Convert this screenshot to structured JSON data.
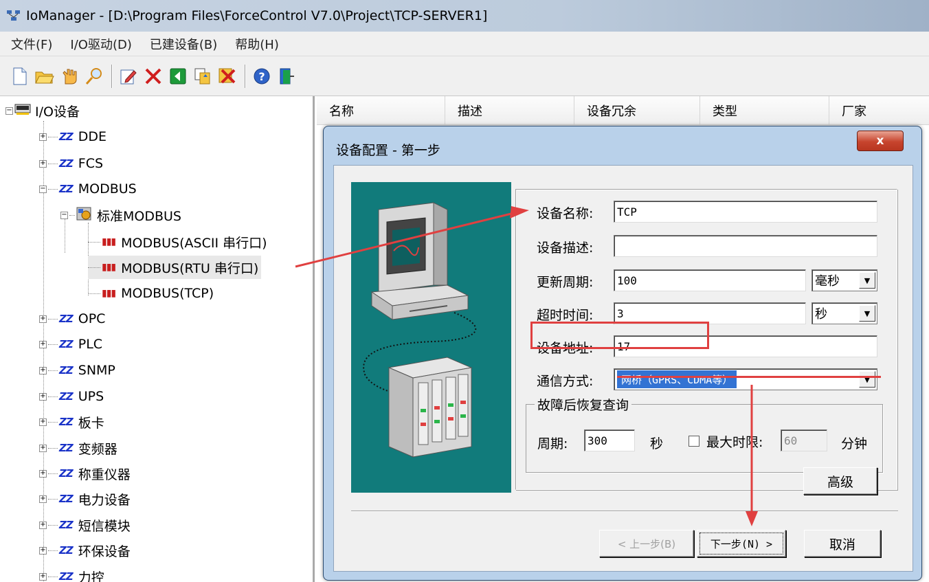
{
  "window": {
    "title": "IoManager - [D:\\Program Files\\ForceControl V7.0\\Project\\TCP-SERVER1]"
  },
  "menu": [
    "文件(F)",
    "I/O驱动(D)",
    "已建设备(B)",
    "帮助(H)"
  ],
  "toolbar": {
    "icons": [
      "new-icon",
      "open-icon",
      "hand-icon",
      "find-icon",
      "edit-icon",
      "delete-icon",
      "import-icon",
      "copy-icon",
      "delete-all-icon",
      "help-icon",
      "exit-icon"
    ]
  },
  "tree": {
    "root": "I/O设备",
    "items": [
      "DDE",
      "FCS",
      "MODBUS",
      "标准MODBUS",
      "MODBUS(ASCII 串行口)",
      "MODBUS(RTU 串行口)",
      "MODBUS(TCP)",
      "OPC",
      "PLC",
      "SNMP",
      "UPS",
      "板卡",
      "变频器",
      "称重仪器",
      "电力设备",
      "短信模块",
      "环保设备",
      "力控"
    ]
  },
  "list": {
    "columns": [
      "名称",
      "描述",
      "设备冗余",
      "类型",
      "厂家"
    ]
  },
  "dialog": {
    "title": "设备配置 - 第一步",
    "close": "x",
    "device_name_label": "设备名称:",
    "device_name": "TCP",
    "device_desc_label": "设备描述:",
    "device_desc": "",
    "update_period_label": "更新周期:",
    "update_period": "100",
    "update_unit": "毫秒",
    "timeout_label": "超时时间:",
    "timeout": "3",
    "timeout_unit": "秒",
    "address_label": "设备地址:",
    "address": "17",
    "comm_label": "通信方式:",
    "comm_value": "网桥（GPRS、CDMA等）",
    "recovery_group": "故障后恢复查询",
    "period_label": "周期:",
    "period_value": "300",
    "period_unit": "秒",
    "max_limit_label": "最大时限:",
    "max_limit_value": "60",
    "max_limit_unit": "分钟",
    "advanced": "高级",
    "prev": "< 上一步(B)",
    "next": "下一步(N) >",
    "cancel": "取消"
  },
  "colors": {
    "art_bg": "#117b7b",
    "annotation": "#e04040",
    "selection": "#3373d3"
  }
}
